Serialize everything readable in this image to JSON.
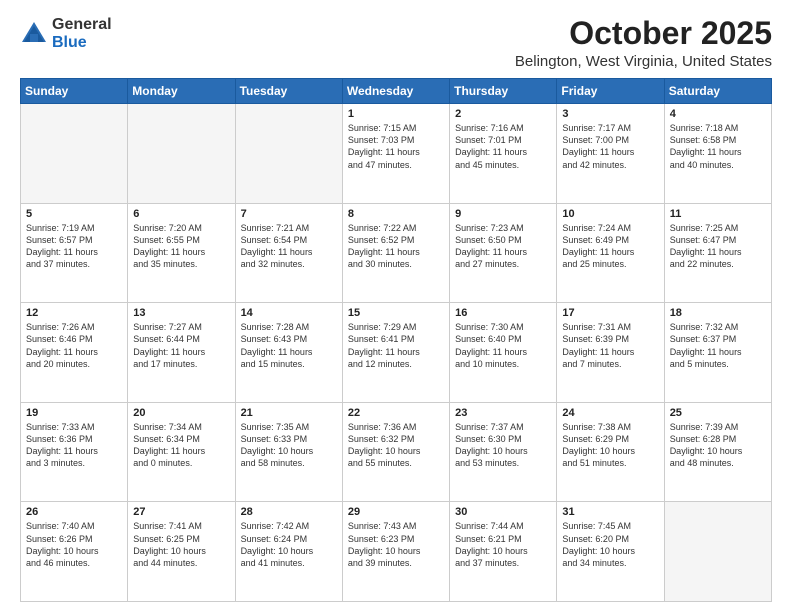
{
  "logo": {
    "general": "General",
    "blue": "Blue"
  },
  "header": {
    "month": "October 2025",
    "location": "Belington, West Virginia, United States"
  },
  "weekdays": [
    "Sunday",
    "Monday",
    "Tuesday",
    "Wednesday",
    "Thursday",
    "Friday",
    "Saturday"
  ],
  "weeks": [
    [
      {
        "day": "",
        "info": ""
      },
      {
        "day": "",
        "info": ""
      },
      {
        "day": "",
        "info": ""
      },
      {
        "day": "1",
        "info": "Sunrise: 7:15 AM\nSunset: 7:03 PM\nDaylight: 11 hours\nand 47 minutes."
      },
      {
        "day": "2",
        "info": "Sunrise: 7:16 AM\nSunset: 7:01 PM\nDaylight: 11 hours\nand 45 minutes."
      },
      {
        "day": "3",
        "info": "Sunrise: 7:17 AM\nSunset: 7:00 PM\nDaylight: 11 hours\nand 42 minutes."
      },
      {
        "day": "4",
        "info": "Sunrise: 7:18 AM\nSunset: 6:58 PM\nDaylight: 11 hours\nand 40 minutes."
      }
    ],
    [
      {
        "day": "5",
        "info": "Sunrise: 7:19 AM\nSunset: 6:57 PM\nDaylight: 11 hours\nand 37 minutes."
      },
      {
        "day": "6",
        "info": "Sunrise: 7:20 AM\nSunset: 6:55 PM\nDaylight: 11 hours\nand 35 minutes."
      },
      {
        "day": "7",
        "info": "Sunrise: 7:21 AM\nSunset: 6:54 PM\nDaylight: 11 hours\nand 32 minutes."
      },
      {
        "day": "8",
        "info": "Sunrise: 7:22 AM\nSunset: 6:52 PM\nDaylight: 11 hours\nand 30 minutes."
      },
      {
        "day": "9",
        "info": "Sunrise: 7:23 AM\nSunset: 6:50 PM\nDaylight: 11 hours\nand 27 minutes."
      },
      {
        "day": "10",
        "info": "Sunrise: 7:24 AM\nSunset: 6:49 PM\nDaylight: 11 hours\nand 25 minutes."
      },
      {
        "day": "11",
        "info": "Sunrise: 7:25 AM\nSunset: 6:47 PM\nDaylight: 11 hours\nand 22 minutes."
      }
    ],
    [
      {
        "day": "12",
        "info": "Sunrise: 7:26 AM\nSunset: 6:46 PM\nDaylight: 11 hours\nand 20 minutes."
      },
      {
        "day": "13",
        "info": "Sunrise: 7:27 AM\nSunset: 6:44 PM\nDaylight: 11 hours\nand 17 minutes."
      },
      {
        "day": "14",
        "info": "Sunrise: 7:28 AM\nSunset: 6:43 PM\nDaylight: 11 hours\nand 15 minutes."
      },
      {
        "day": "15",
        "info": "Sunrise: 7:29 AM\nSunset: 6:41 PM\nDaylight: 11 hours\nand 12 minutes."
      },
      {
        "day": "16",
        "info": "Sunrise: 7:30 AM\nSunset: 6:40 PM\nDaylight: 11 hours\nand 10 minutes."
      },
      {
        "day": "17",
        "info": "Sunrise: 7:31 AM\nSunset: 6:39 PM\nDaylight: 11 hours\nand 7 minutes."
      },
      {
        "day": "18",
        "info": "Sunrise: 7:32 AM\nSunset: 6:37 PM\nDaylight: 11 hours\nand 5 minutes."
      }
    ],
    [
      {
        "day": "19",
        "info": "Sunrise: 7:33 AM\nSunset: 6:36 PM\nDaylight: 11 hours\nand 3 minutes."
      },
      {
        "day": "20",
        "info": "Sunrise: 7:34 AM\nSunset: 6:34 PM\nDaylight: 11 hours\nand 0 minutes."
      },
      {
        "day": "21",
        "info": "Sunrise: 7:35 AM\nSunset: 6:33 PM\nDaylight: 10 hours\nand 58 minutes."
      },
      {
        "day": "22",
        "info": "Sunrise: 7:36 AM\nSunset: 6:32 PM\nDaylight: 10 hours\nand 55 minutes."
      },
      {
        "day": "23",
        "info": "Sunrise: 7:37 AM\nSunset: 6:30 PM\nDaylight: 10 hours\nand 53 minutes."
      },
      {
        "day": "24",
        "info": "Sunrise: 7:38 AM\nSunset: 6:29 PM\nDaylight: 10 hours\nand 51 minutes."
      },
      {
        "day": "25",
        "info": "Sunrise: 7:39 AM\nSunset: 6:28 PM\nDaylight: 10 hours\nand 48 minutes."
      }
    ],
    [
      {
        "day": "26",
        "info": "Sunrise: 7:40 AM\nSunset: 6:26 PM\nDaylight: 10 hours\nand 46 minutes."
      },
      {
        "day": "27",
        "info": "Sunrise: 7:41 AM\nSunset: 6:25 PM\nDaylight: 10 hours\nand 44 minutes."
      },
      {
        "day": "28",
        "info": "Sunrise: 7:42 AM\nSunset: 6:24 PM\nDaylight: 10 hours\nand 41 minutes."
      },
      {
        "day": "29",
        "info": "Sunrise: 7:43 AM\nSunset: 6:23 PM\nDaylight: 10 hours\nand 39 minutes."
      },
      {
        "day": "30",
        "info": "Sunrise: 7:44 AM\nSunset: 6:21 PM\nDaylight: 10 hours\nand 37 minutes."
      },
      {
        "day": "31",
        "info": "Sunrise: 7:45 AM\nSunset: 6:20 PM\nDaylight: 10 hours\nand 34 minutes."
      },
      {
        "day": "",
        "info": ""
      }
    ]
  ]
}
